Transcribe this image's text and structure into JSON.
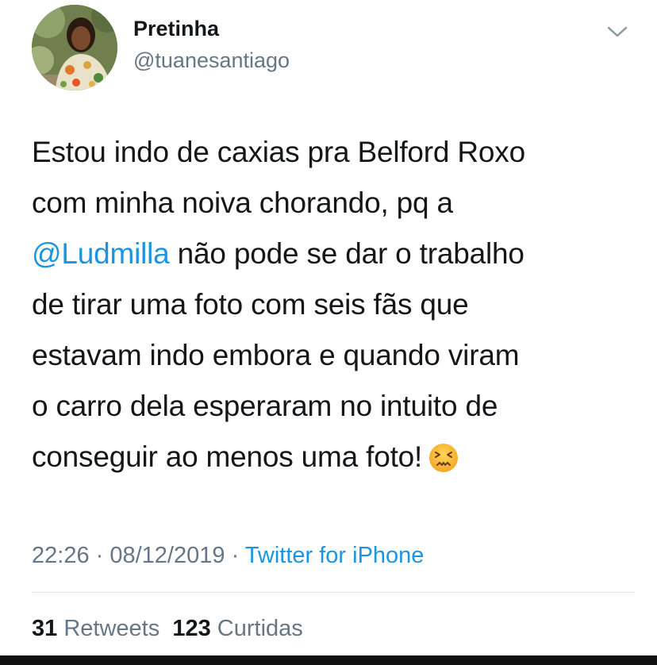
{
  "user": {
    "display_name": "Pretinha",
    "handle": "@tuanesantiago"
  },
  "tweet": {
    "lines": [
      {
        "text": "Estou indo de caxias pra Belford Roxo"
      },
      {
        "text": "com minha noiva chorando, pq a"
      },
      {
        "mention": "@Ludmilla",
        "text": " não pode se dar o trabalho"
      },
      {
        "text": "de tirar uma foto com seis fãs que"
      },
      {
        "text": "estavam indo embora e quando viram"
      },
      {
        "text": "o carro dela esperaram no intuito de"
      },
      {
        "text": "conseguir ao menos uma foto!",
        "emoji": "persevering-face-emoji"
      }
    ]
  },
  "meta": {
    "time": "22:26",
    "separator1": " · ",
    "date": "08/12/2019",
    "separator2": " · ",
    "source": "Twitter for iPhone"
  },
  "stats": {
    "retweets_count": "31",
    "retweets_label": " Retweets",
    "likes_count": "123",
    "likes_label": " Curtidas"
  },
  "icons": {
    "more": "chevron-down-icon"
  },
  "colors": {
    "link": "#1b95e0",
    "secondary_text": "#657786",
    "primary_text": "#14171a",
    "divider": "#e1e8ed"
  }
}
